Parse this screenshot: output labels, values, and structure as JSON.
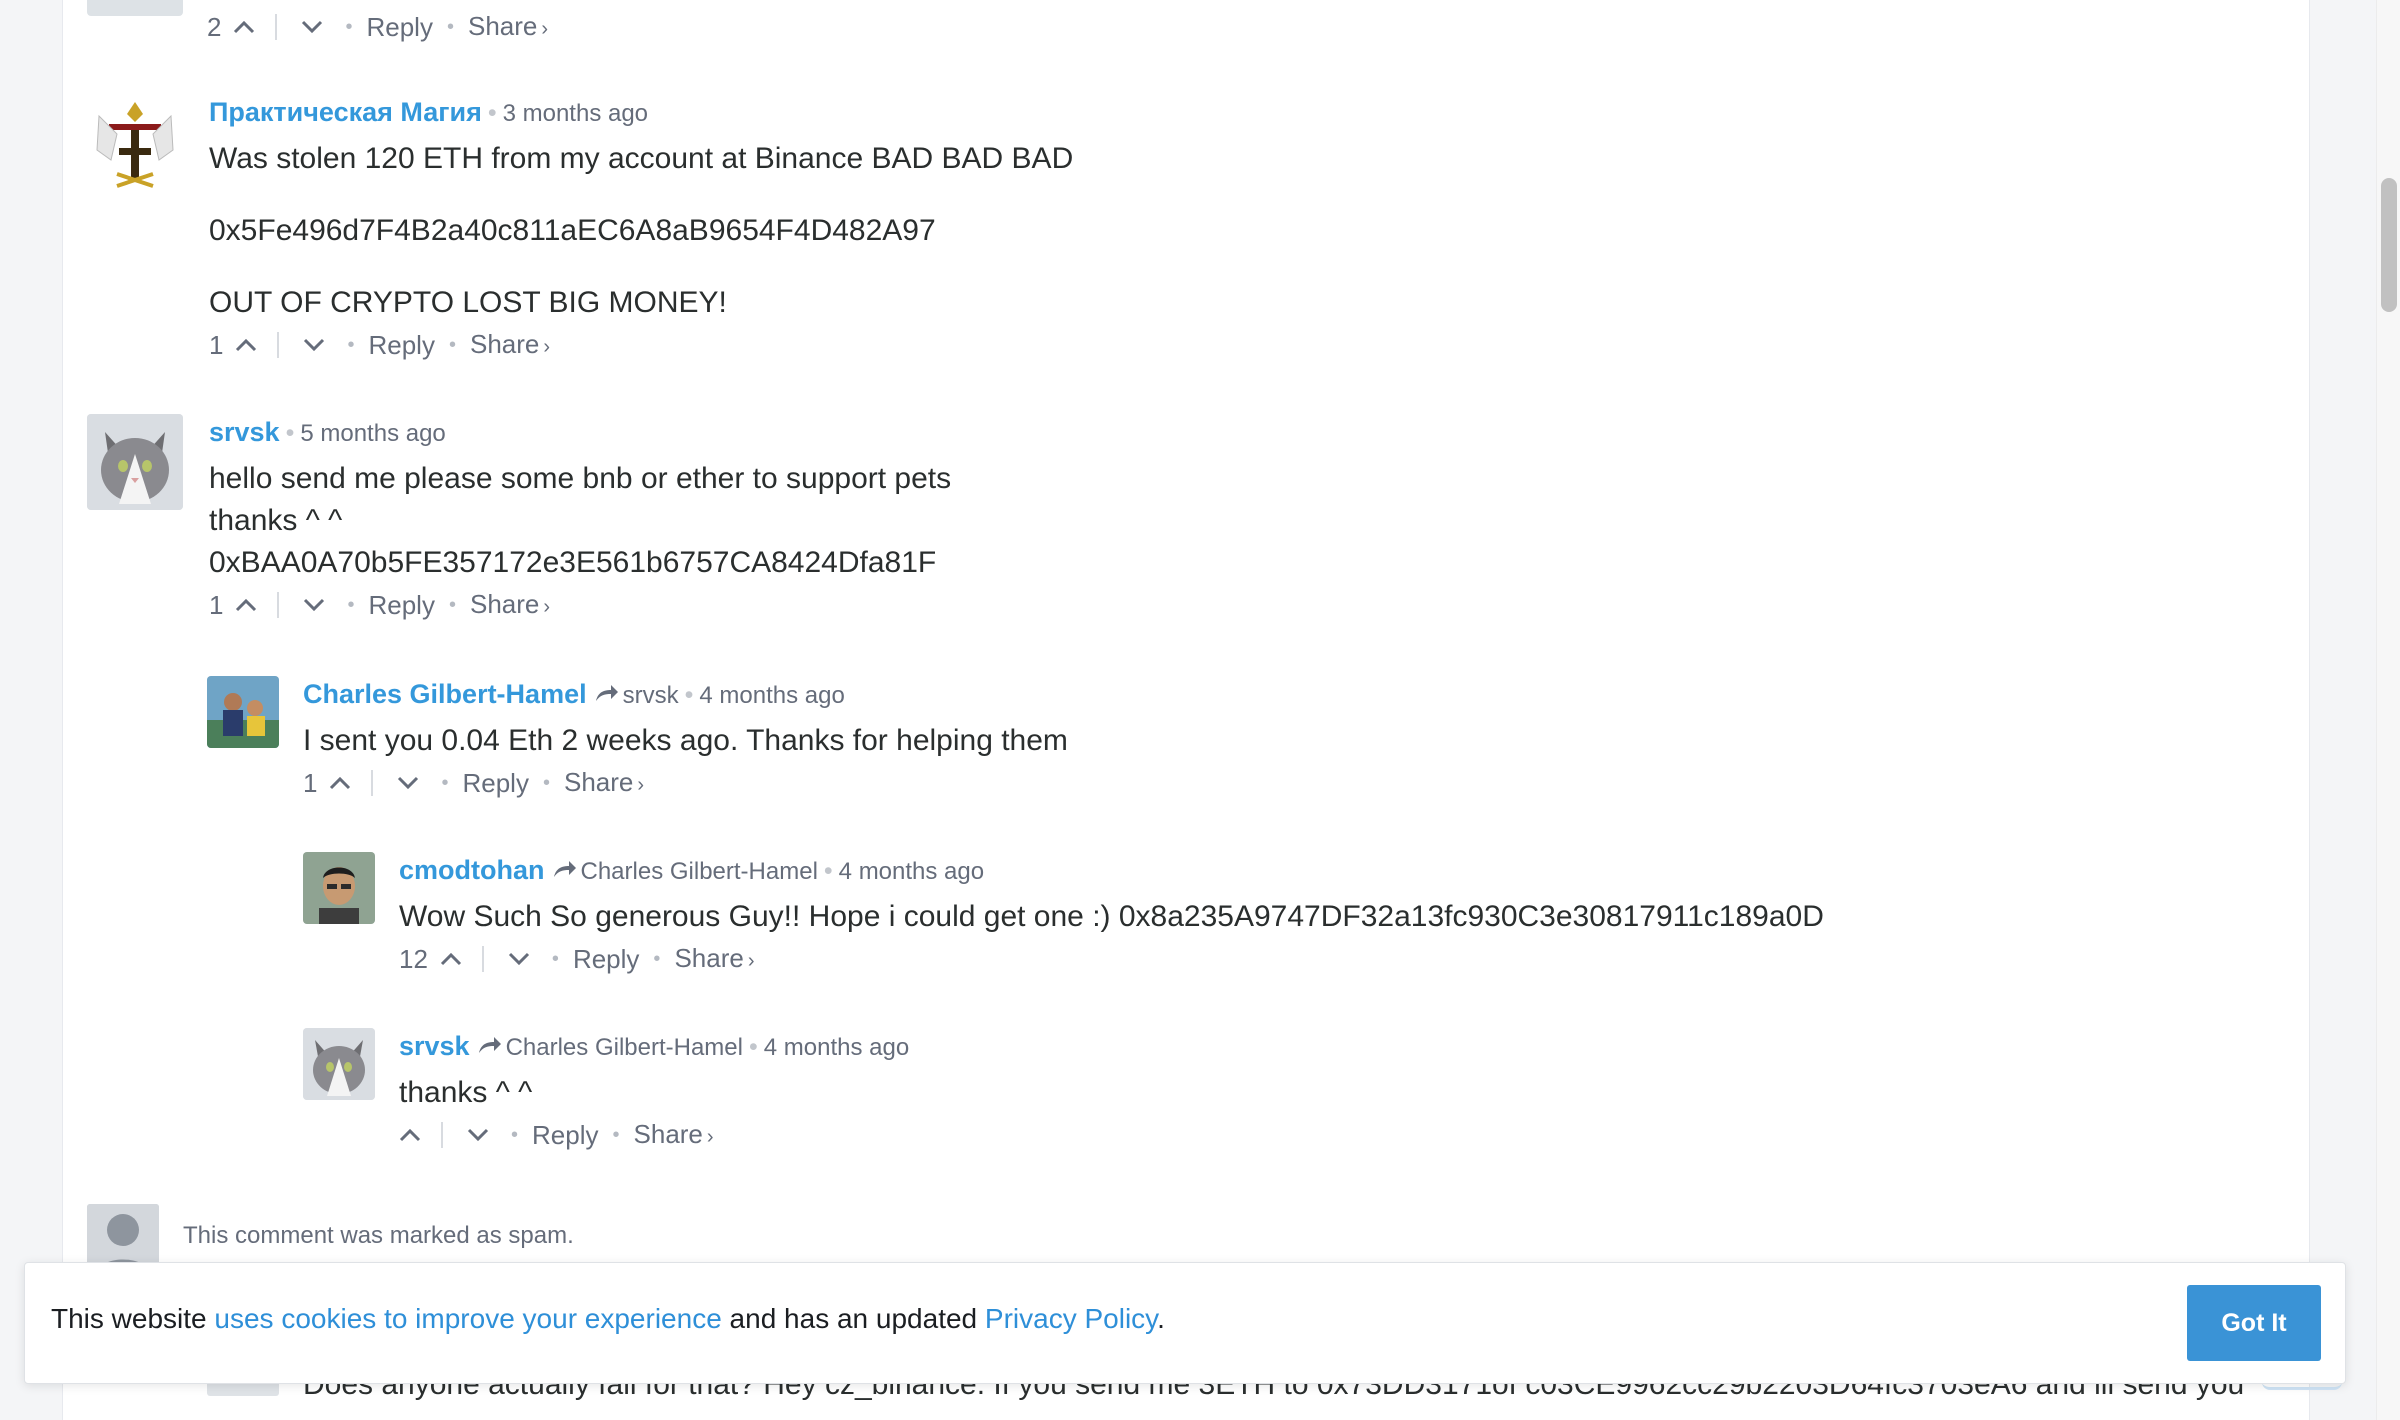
{
  "comments": [
    {
      "count": "2",
      "reply": "Reply",
      "share": "Share",
      "share_chevron": "›"
    },
    {
      "author": "Практическая Магия",
      "time": "3 months ago",
      "lines": [
        "Was stolen 120 ETH from my account at Binance BAD BAD BAD",
        "0x5Fe496d7F4B2a40c811aEC6A8aB9654F4D482A97",
        "OUT OF CRYPTO LOST BIG MONEY!"
      ],
      "count": "1",
      "reply": "Reply",
      "share": "Share",
      "share_chevron": "›"
    },
    {
      "author": "srvsk",
      "time": "5 months ago",
      "lines": [
        "hello send me please some bnb or ether to support pets",
        "thanks ^ ^",
        "0xBAA0A70b5FE357172e3E561b6757CA8424Dfa81F"
      ],
      "count": "1",
      "reply": "Reply",
      "share": "Share",
      "share_chevron": "›"
    },
    {
      "author": "Charles Gilbert-Hamel",
      "parent": "srvsk",
      "time": "4 months ago",
      "lines": [
        "I sent you 0.04 Eth 2 weeks ago. Thanks for helping them"
      ],
      "count": "1",
      "reply": "Reply",
      "share": "Share",
      "share_chevron": "›"
    },
    {
      "author": "cmodtohan",
      "parent": "Charles Gilbert-Hamel",
      "time": "4 months ago",
      "lines": [
        "Wow Such So generous Guy!! Hope i could get one :) 0x8a235A9747DF32a13fc930C3e30817911c189a0D"
      ],
      "count": "12",
      "reply": "Reply",
      "share": "Share",
      "share_chevron": "›"
    },
    {
      "author": "srvsk",
      "parent": "Charles Gilbert-Hamel",
      "time": "4 months ago",
      "lines": [
        "thanks ^ ^"
      ],
      "count": "",
      "reply": "Reply",
      "share": "Share",
      "share_chevron": "›"
    }
  ],
  "spam_notice": "This comment was marked as spam.",
  "obscured_comment": "Does anyone actually fall for that? Hey cz_binance. If you send me 3ETH to 0x73DD3171of c03CE9962cc29b2203D64fc3703eA6 and ill send you",
  "cookie": {
    "prefix": "This website ",
    "link1": "uses cookies to improve your experience",
    "middle": " and has an updated ",
    "link2": "Privacy Policy",
    "suffix": ".",
    "button": "Got It"
  },
  "colors": {
    "author": "#3498db",
    "meta": "#656c7a",
    "button": "#3a93d6"
  },
  "icons": [
    "upvote-icon",
    "downvote-icon",
    "reply-arrow-icon"
  ]
}
